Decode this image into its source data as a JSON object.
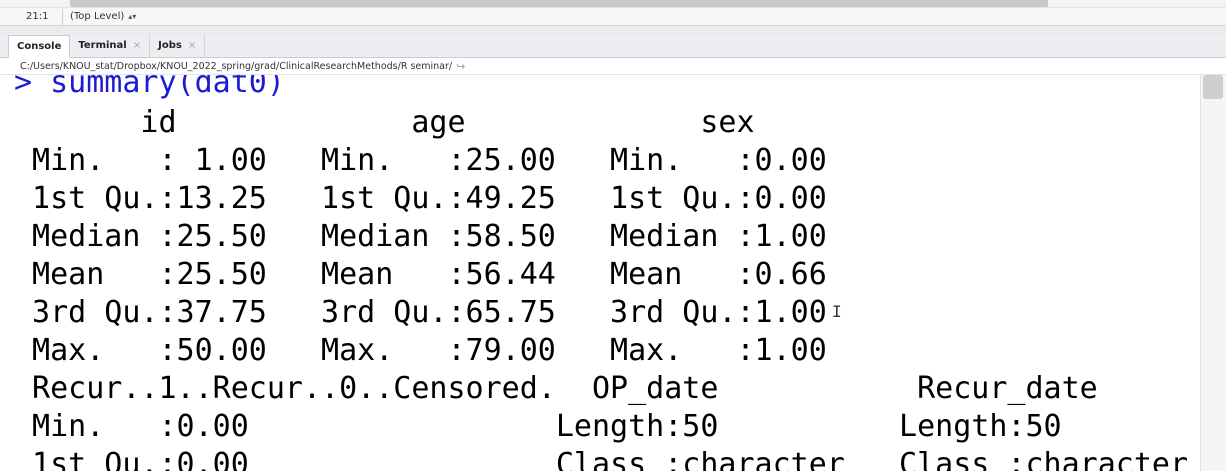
{
  "editor_status": {
    "cursor_position": "21:1",
    "scope": "(Top Level)",
    "scope_caret": "⬍"
  },
  "tabs": [
    {
      "label": "Console",
      "closable": false
    },
    {
      "label": "Terminal",
      "closable": true
    },
    {
      "label": "Jobs",
      "closable": true
    }
  ],
  "close_glyph": "×",
  "working_directory": "C:/Users/KNOU_stat/Dropbox/KNOU_2022_spring/grad/ClinicalResearchMethods/R seminar/",
  "console": {
    "prompt_line": "> summary(dat0)",
    "output_lines": [
      "       id             age             sex      ",
      " Min.   : 1.00   Min.   :25.00   Min.   :0.00  ",
      " 1st Qu.:13.25   1st Qu.:49.25   1st Qu.:0.00  ",
      " Median :25.50   Median :58.50   Median :1.00  ",
      " Mean   :25.50   Mean   :56.44   Mean   :0.66  ",
      " 3rd Qu.:37.75   3rd Qu.:65.75   3rd Qu.:1.00  ",
      " Max.   :50.00   Max.   :79.00   Max.   :1.00  ",
      " Recur..1..Recur..0..Censored.  OP_date           Recur_date      ",
      " Min.   :0.00                 Length:50          Length:50         ",
      " 1st Qu.:0.00                 Class :character   Class :character  "
    ]
  },
  "colors": {
    "prompt": "#1b1bd6",
    "output": "#000000",
    "tabbar_bg": "#eceef1"
  },
  "icons": {
    "dir_arrow": "share-arrow-icon",
    "text_cursor": "i-beam-cursor-icon"
  }
}
